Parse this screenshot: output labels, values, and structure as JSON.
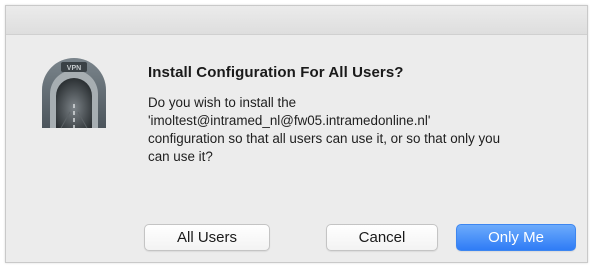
{
  "dialog": {
    "title": "Install Configuration For All Users?",
    "message_lines": [
      "Do you wish to install the",
      "'imoltest@intramed_nl@fw05.intramedonline.nl'",
      "configuration so that all users can use it, or so that only you",
      "can use it?"
    ],
    "icon": {
      "name": "vpn-tunnel-icon",
      "badge_text": "VPN"
    },
    "buttons": {
      "all_users": "All Users",
      "cancel": "Cancel",
      "only_me": "Only Me"
    },
    "colors": {
      "default_button": "#2f7cf6",
      "background": "#ececec"
    }
  }
}
